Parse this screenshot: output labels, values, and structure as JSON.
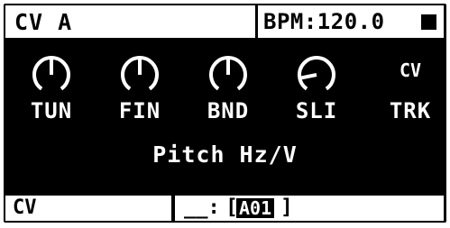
{
  "header": {
    "title": "CV A",
    "tempo": "BPM:120.0",
    "transport_icon": "stop-icon"
  },
  "knobs": [
    {
      "label": "TUN",
      "level": 0.5
    },
    {
      "label": "FIN",
      "level": 0.5
    },
    {
      "label": "BND",
      "level": 0.5
    },
    {
      "label": "SLI",
      "level": 0.15
    }
  ],
  "cv_track": {
    "badge": "CV",
    "label": "TRK"
  },
  "parameter_description": "Pitch Hz/V",
  "footer": {
    "page": "CV",
    "prefix": "__:",
    "bracket_open": "[",
    "pattern": "A01",
    "bracket_close": "]"
  },
  "colors": {
    "screen": "#000000",
    "foreground": "#ffffff"
  }
}
